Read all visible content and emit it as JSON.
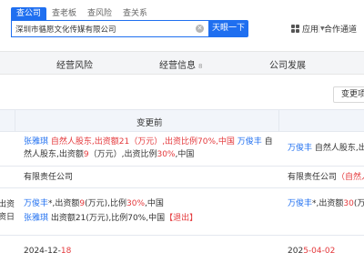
{
  "header": {
    "search_tabs": [
      "查公司",
      "查老板",
      "查风险",
      "查关系"
    ],
    "search_value": "深圳市循愿文化传媒有限公司",
    "search_button": "天眼一下",
    "app_label": "应用",
    "partner_label": "合作通道"
  },
  "subnav": {
    "items": [
      {
        "label": "经营风险",
        "count": ""
      },
      {
        "label": "经营信息",
        "count": "8"
      },
      {
        "label": "公司发展",
        "count": ""
      }
    ]
  },
  "toolbar": {
    "filter_label": "变更项目"
  },
  "table": {
    "header_before": "变更前",
    "rows": [
      {
        "left": "",
        "before_line1": {
          "name1": "张雅琪",
          "text1": " 自然人股东,出资额21（万元）,出资比例70%,中国 ",
          "name2": "万俊丰",
          "text2": " 自"
        },
        "before_line2": {
          "text1": "然人股东,出资额",
          "num": "9",
          "text2": "（万元）,出资比例",
          "pct": "30%",
          "text3": ",中国"
        },
        "after_line1": {
          "name": "万俊丰",
          "text": " 自然人股东,出"
        }
      },
      {
        "left": "",
        "before": "有限责任公司",
        "after": "有限责任公司（自然人"
      },
      {
        "left_lines": [
          "出资",
          "资日"
        ],
        "before_line1": {
          "name": "万俊丰",
          "text1": "*,出资额",
          "num": "9",
          "text2": "(万元),比例",
          "pct": "30%",
          "text3": ",中国"
        },
        "before_line2": {
          "name": "张雅琪",
          "text1": " 出资额21(万元),比例70%,中国",
          "tag": "【退出】"
        },
        "after_line1": {
          "name": "万俊丰",
          "text1": "*,出资额",
          "num": "30",
          "text2": "(万"
        }
      },
      {
        "before_date": "2024-12-18",
        "after_date": "2025-04-02"
      }
    ]
  },
  "colors": {
    "accent": "#1f6ff0",
    "warning": "#e4393c",
    "header_bg": "#f2f5fa"
  }
}
